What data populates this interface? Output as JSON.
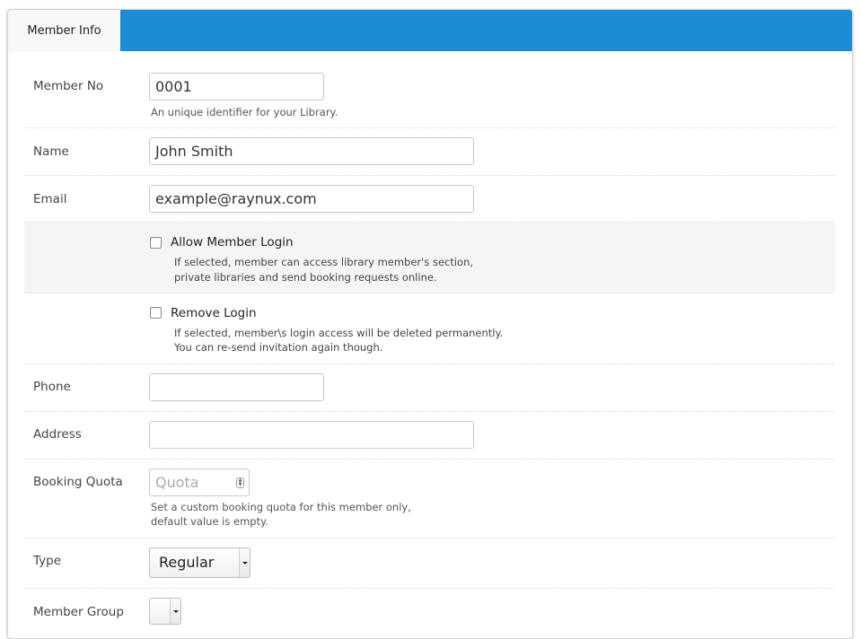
{
  "tabs": {
    "member_info": "Member Info"
  },
  "colors": {
    "tabbar": "#1e8bd5"
  },
  "member_no": {
    "label": "Member No",
    "value": "0001",
    "help": "An unique identifier for your Library."
  },
  "name": {
    "label": "Name",
    "value": "John Smith"
  },
  "email": {
    "label": "Email",
    "value": "example@raynux.com"
  },
  "allow_login": {
    "label": "Allow Member Login",
    "help_line1": "If selected, member can access library member's section,",
    "help_line2": "private libraries and send booking requests online."
  },
  "remove_login": {
    "label": "Remove Login",
    "help_line1": "If selected, member\\s login access will be deleted permanently.",
    "help_line2": "You can re-send invitation again though."
  },
  "phone": {
    "label": "Phone",
    "value": ""
  },
  "address": {
    "label": "Address",
    "value": ""
  },
  "booking_quota": {
    "label": "Booking Quota",
    "placeholder": "Quota",
    "help_line1": "Set a custom booking quota for this member only,",
    "help_line2": "default value is empty."
  },
  "type": {
    "label": "Type",
    "selected": "Regular"
  },
  "member_group": {
    "label": "Member Group",
    "selected": ""
  }
}
